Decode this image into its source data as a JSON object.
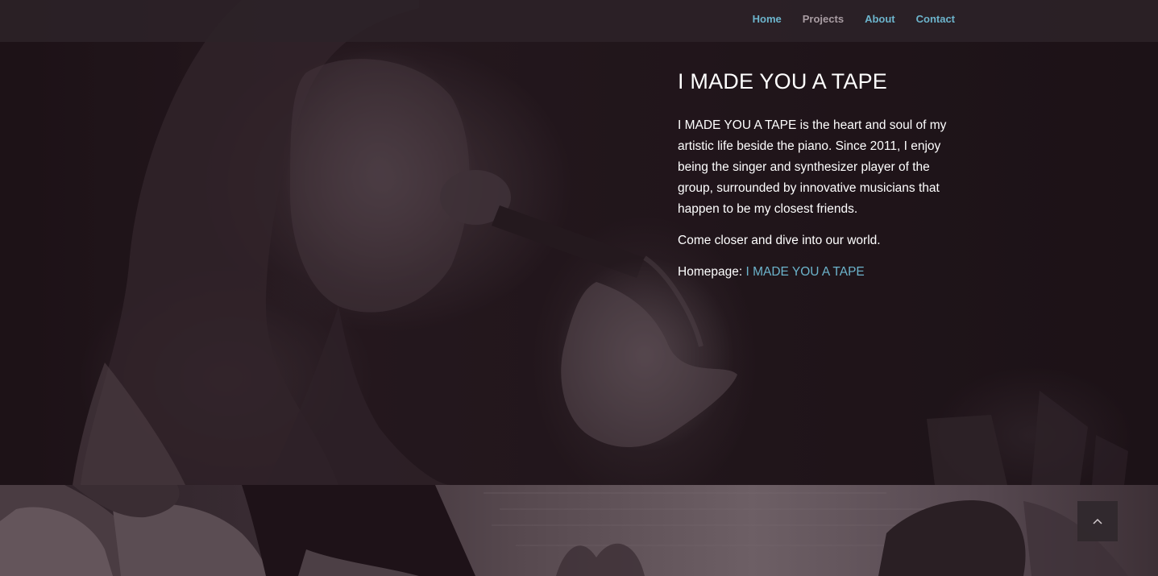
{
  "nav": {
    "items": [
      {
        "label": "Home",
        "color": "#6cb4cc"
      },
      {
        "label": "Projects",
        "color": "#a99da3"
      },
      {
        "label": "About",
        "color": "#6cb4cc"
      },
      {
        "label": "Contact",
        "color": "#6cb4cc"
      }
    ]
  },
  "hero": {
    "title": "I MADE YOU A TAPE",
    "paragraph_1": "I MADE YOU A TAPE is the heart and soul of my artistic life beside the piano. Since 2011, I enjoy being the singer and synthesizer player of the group, surrounded by innovative musicians that happen to be my closest friends.",
    "paragraph_2": "Come closer and dive into our world.",
    "homepage_label": "Homepage: ",
    "homepage_link": "I MADE YOU A TAPE"
  },
  "scroll_top": {
    "icon": "chevron-up-icon",
    "glyph": "^"
  },
  "colors": {
    "link": "#6cb4cc",
    "nav_inactive": "#a99da3",
    "text": "#ffffff",
    "overlay": "#1e1218"
  }
}
